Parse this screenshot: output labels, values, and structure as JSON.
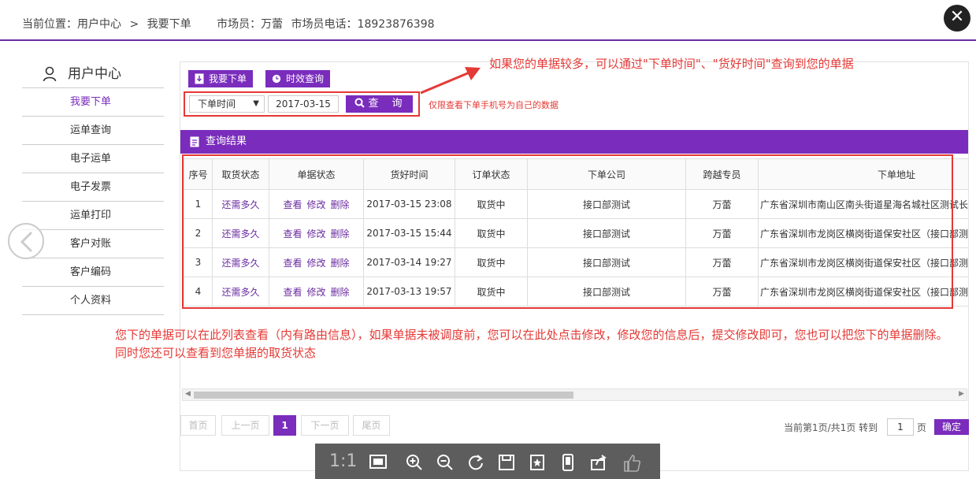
{
  "breadcrumb": {
    "location_label": "当前位置：用户中心",
    "separator": ">",
    "current": "我要下单",
    "marketer_label": "市场员：万蕾",
    "marketer_phone_label": "市场员电话：18923876398"
  },
  "sidebar": {
    "title": "用户中心",
    "items": [
      {
        "label": "我要下单",
        "active": true
      },
      {
        "label": "运单查询"
      },
      {
        "label": "电子运单"
      },
      {
        "label": "电子发票"
      },
      {
        "label": "运单打印"
      },
      {
        "label": "客户对账"
      },
      {
        "label": "客户编码"
      },
      {
        "label": "个人资料"
      }
    ]
  },
  "toolbar": {
    "order_btn": "我要下单",
    "timeliness_btn": "时效查询"
  },
  "search": {
    "select_value": "下单时间",
    "date_value": "2017-03-15",
    "query_btn": "查　询",
    "hint": "仅限查看下单手机号为自己的数据"
  },
  "annotations": {
    "note_top": "如果您的单据较多，可以通过\"下单时间\"、\"货好时间\"查询到您的单据",
    "note_bottom": "您下的单据可以在此列表查看（内有路由信息），如果单据未被调度前，您可以在此处点击修改，修改您的信息后，提交修改即可，您也可以把您下的单据删除。同时您还可以查看到您单据的取货状态"
  },
  "results": {
    "title": "查询结果",
    "columns": [
      "序号",
      "取货状态",
      "单据状态",
      "货好时间",
      "订单状态",
      "下单公司",
      "跨越专员",
      "下单地址"
    ],
    "action_view": "查看",
    "action_edit": "修改",
    "action_delete": "删除",
    "rows": [
      {
        "no": "1",
        "pickup": "还需多久",
        "ready_time": "2017-03-15 23:08",
        "order_status": "取货中",
        "company": "接口部测试",
        "agent": "万蕾",
        "address": "广东省深圳市南山区南头街道星海名城社区测试长久"
      },
      {
        "no": "2",
        "pickup": "还需多久",
        "ready_time": "2017-03-15 15:44",
        "order_status": "取货中",
        "company": "接口部测试",
        "agent": "万蕾",
        "address": "广东省深圳市龙岗区横岗街道保安社区（接口部测试"
      },
      {
        "no": "3",
        "pickup": "还需多久",
        "ready_time": "2017-03-14 19:27",
        "order_status": "取货中",
        "company": "接口部测试",
        "agent": "万蕾",
        "address": "广东省深圳市龙岗区横岗街道保安社区（接口部测试"
      },
      {
        "no": "4",
        "pickup": "还需多久",
        "ready_time": "2017-03-13 19:57",
        "order_status": "取货中",
        "company": "接口部测试",
        "agent": "万蕾",
        "address": "广东省深圳市龙岗区横岗街道保安社区（接口部测试"
      }
    ]
  },
  "pagination": {
    "first": "首页",
    "prev": "上一页",
    "current": "1",
    "next": "下一页",
    "last": "尾页",
    "info": "当前第1页/共1页 转到",
    "goto_value": "1",
    "unit": "页",
    "confirm": "确定"
  },
  "viewer": {
    "actual_size": "1:1"
  },
  "colors": {
    "accent": "#7a2cbc",
    "annotation": "#e53935"
  }
}
